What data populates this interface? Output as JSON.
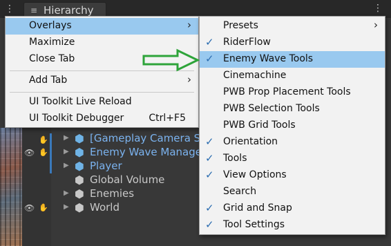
{
  "window": {
    "tab_title": "Hierarchy",
    "tab_icon": "≡",
    "kebab": "⋮",
    "right_kebab": "⋮"
  },
  "hierarchy": {
    "rows": [
      {
        "name": "[Gameplay Camera Sy",
        "color": "blue"
      },
      {
        "name": "Enemy Wave Manage",
        "color": "blue"
      },
      {
        "name": "Player",
        "color": "blue"
      },
      {
        "name": "Global Volume",
        "color": "grey"
      },
      {
        "name": "Enemies",
        "color": "grey"
      },
      {
        "name": "World",
        "color": "grey"
      }
    ],
    "fold_icon": "▶",
    "cube_icon": "⬢",
    "eye_icon": "👁",
    "pick_icon": "✋"
  },
  "context_menu": {
    "items": [
      {
        "label": "Overlays",
        "arrow": "›",
        "highlighted": true
      },
      {
        "label": "Maximize"
      },
      {
        "label": "Close Tab"
      },
      {
        "label": "Add Tab",
        "arrow": "›"
      },
      {
        "label": "UI Toolkit Live Reload"
      },
      {
        "label": "UI Toolkit Debugger",
        "shortcut": "Ctrl+F5"
      }
    ]
  },
  "overlays_menu": {
    "items": [
      {
        "label": "Presets",
        "arrow": "›",
        "checked": false
      },
      {
        "label": "RiderFlow",
        "checked": true
      },
      {
        "label": "Enemy Wave Tools",
        "checked": true,
        "highlighted": true
      },
      {
        "label": "Cinemachine",
        "checked": false
      },
      {
        "label": "PWB Prop Placement Tools",
        "checked": false
      },
      {
        "label": "PWB Selection Tools",
        "checked": false
      },
      {
        "label": "PWB Grid Tools",
        "checked": false
      },
      {
        "label": "Orientation",
        "checked": true
      },
      {
        "label": "Tools",
        "checked": true
      },
      {
        "label": "View Options",
        "checked": true
      },
      {
        "label": "Search",
        "checked": false
      },
      {
        "label": "Grid and Snap",
        "checked": true
      },
      {
        "label": "Tool Settings",
        "checked": true
      }
    ],
    "check_glyph": "✓"
  },
  "colors": {
    "highlight": "#99c9ef",
    "menu_bg": "#f2f2f2",
    "annotation_arrow": "#2ea43a",
    "hierarchy_blue": "#7bb3ef"
  }
}
